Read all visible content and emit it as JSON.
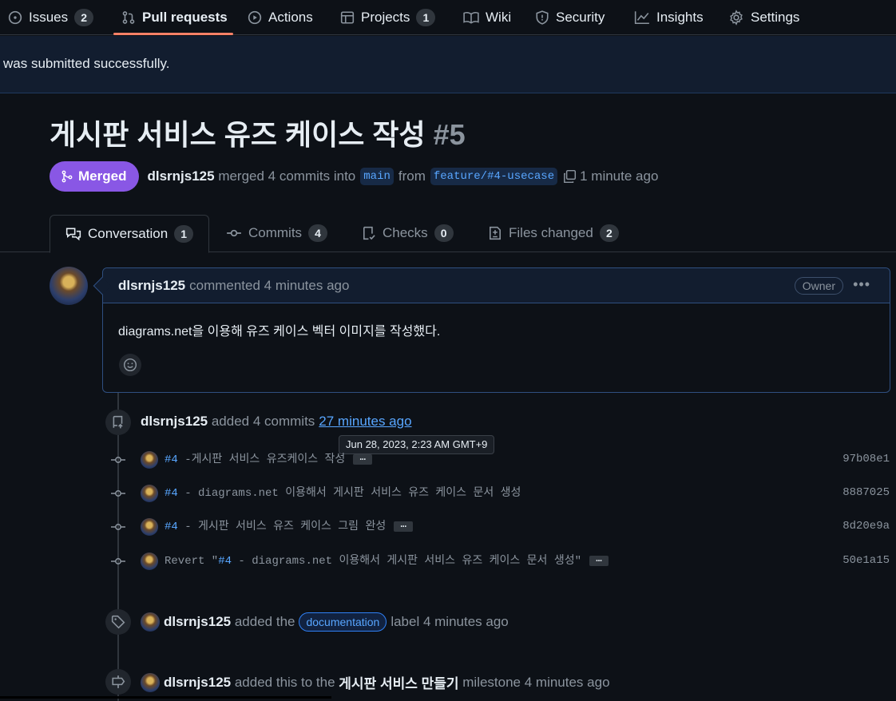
{
  "nav": {
    "items": [
      {
        "label": "Issues",
        "count": "2",
        "icon": "issue-opened-icon"
      },
      {
        "label": "Pull requests",
        "icon": "git-pull-request-icon",
        "active": true
      },
      {
        "label": "Actions",
        "icon": "play-icon"
      },
      {
        "label": "Projects",
        "count": "1",
        "icon": "table-icon"
      },
      {
        "label": "Wiki",
        "icon": "book-icon"
      },
      {
        "label": "Security",
        "icon": "shield-icon"
      },
      {
        "label": "Insights",
        "icon": "graph-icon"
      },
      {
        "label": "Settings",
        "icon": "gear-icon"
      }
    ],
    "active_color": "#f78166"
  },
  "flash": {
    "message": "was submitted successfully."
  },
  "pr": {
    "title": "게시판 서비스 유즈 케이스 작성",
    "number": "#5",
    "state": "Merged",
    "author": "dlsrnjs125",
    "merge_text": "merged 4 commits into",
    "base_branch": "main",
    "from_text": "from",
    "head_branch": "feature/#4-usecase",
    "time": "1 minute ago",
    "merged_color": "#8957e5"
  },
  "tabs": [
    {
      "label": "Conversation",
      "count": "1",
      "icon": "comment-discussion-icon"
    },
    {
      "label": "Commits",
      "count": "4",
      "icon": "git-commit-icon"
    },
    {
      "label": "Checks",
      "count": "0",
      "icon": "checklist-icon"
    },
    {
      "label": "Files changed",
      "count": "2",
      "icon": "file-diff-icon"
    }
  ],
  "comment": {
    "author": "dlsrnjs125",
    "action": "commented 4 minutes ago",
    "role": "Owner",
    "body": "diagrams.net을 이용해 유즈 케이스 벡터 이미지를 작성했다."
  },
  "timeline": {
    "commits_event": {
      "author": "dlsrnjs125",
      "action": "added 4 commits",
      "time_link": "27 minutes ago",
      "tooltip": "Jun 28, 2023, 2:23 AM GMT+9"
    },
    "commits": [
      {
        "prefix": "",
        "ref": "#4",
        "message": " -게시판 서비스 유즈케이스 작성",
        "has_more": true,
        "sha": "97b08e1"
      },
      {
        "prefix": "",
        "ref": "#4",
        "message": " - diagrams.net 이용해서 게시판 서비스 유즈 케이스 문서 생성",
        "has_more": false,
        "sha": "8887025"
      },
      {
        "prefix": "",
        "ref": "#4",
        "message": " - 게시판 서비스 유즈 케이스 그림 완성",
        "has_more": true,
        "sha": "8d20e9a"
      },
      {
        "prefix": "Revert \"",
        "ref": "#4",
        "message": " - diagrams.net 이용해서 게시판 서비스 유즈 케이스 문서 생성\"",
        "has_more": true,
        "sha": "50e1a15"
      }
    ],
    "label_event": {
      "author": "dlsrnjs125",
      "before": "added the",
      "label": "documentation",
      "after": "label 4 minutes ago"
    },
    "milestone_event": {
      "author": "dlsrnjs125",
      "before": "added this to the",
      "milestone": "게시판 서비스 만들기",
      "after": "milestone 4 minutes ago"
    }
  }
}
